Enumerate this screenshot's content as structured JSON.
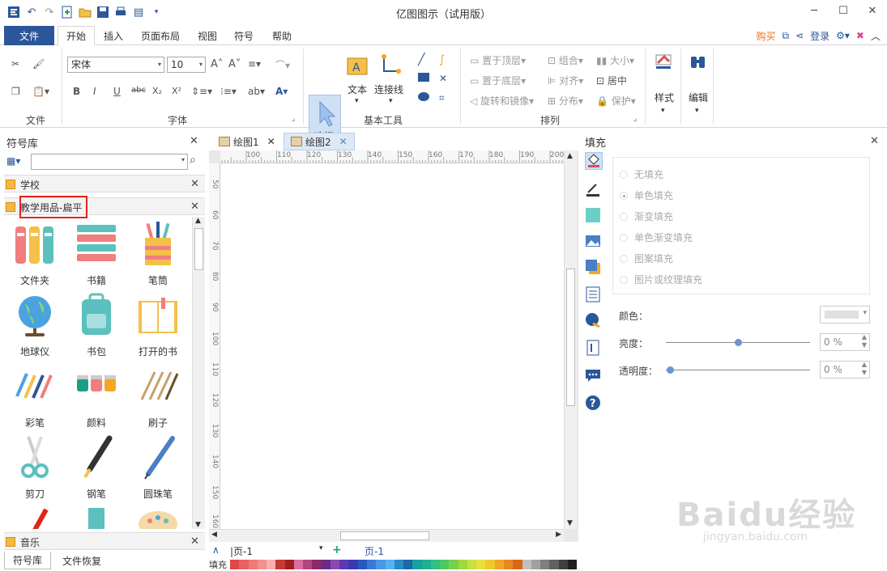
{
  "window": {
    "title": "亿图图示（试用版）"
  },
  "menu": {
    "file": "文件",
    "tabs": [
      "开始",
      "插入",
      "页面布局",
      "视图",
      "符号",
      "帮助"
    ],
    "buy": "购买",
    "login": "登录"
  },
  "ribbon": {
    "groups": {
      "file": "文件",
      "font": "字体",
      "basic": "基本工具",
      "arrange": "排列"
    },
    "font_name": "宋体",
    "font_size": "10",
    "select": "选择",
    "text": "文本",
    "connector": "连接线",
    "bring_top": "置于顶层",
    "send_bottom": "置于底层",
    "rotate": "旋转和镜像",
    "group": "组合",
    "align": "对齐",
    "distribute": "分布",
    "size": "大小",
    "center": "居中",
    "protect": "保护",
    "style": "样式",
    "edit": "编辑"
  },
  "library": {
    "title": "符号库",
    "categories": [
      "学校",
      "教学用品-扁平",
      "音乐"
    ],
    "shapes": [
      "文件夹",
      "书籍",
      "笔筒",
      "地球仪",
      "书包",
      "打开的书",
      "彩笔",
      "颜料",
      "刷子",
      "剪刀",
      "钢笔",
      "圆珠笔"
    ],
    "bottom_tabs": [
      "符号库",
      "文件恢复"
    ]
  },
  "docs": {
    "tabs": [
      "绘图1",
      "绘图2"
    ]
  },
  "ruler": {
    "top": [
      "100",
      "110",
      "120",
      "130",
      "140",
      "150",
      "160",
      "170",
      "180",
      "190",
      "200"
    ],
    "left": [
      "50",
      "60",
      "70",
      "80",
      "90",
      "100",
      "110",
      "120",
      "130",
      "140",
      "150",
      "160"
    ]
  },
  "pagebar": {
    "page_select": "页-1",
    "page_tab": "页-1",
    "fill_label": "填充"
  },
  "fill_panel": {
    "title": "填充",
    "options": [
      "无填充",
      "单色填充",
      "渐变填充",
      "单色渐变填充",
      "图案填充",
      "图片或纹理填充"
    ],
    "selected": 1,
    "color_label": "颜色：",
    "brightness_label": "亮度：",
    "brightness_value": "0 %",
    "brightness_level": 0.5,
    "transparency_label": "透明度：",
    "transparency_value": "0 %",
    "transparency_level": 0.0
  },
  "colors": {
    "brand": "#2b579a",
    "buy": "#e7711b",
    "highlight": "#e2231a"
  },
  "watermark": {
    "main": "Baidu经验",
    "sub": "jingyan.baidu.com"
  }
}
